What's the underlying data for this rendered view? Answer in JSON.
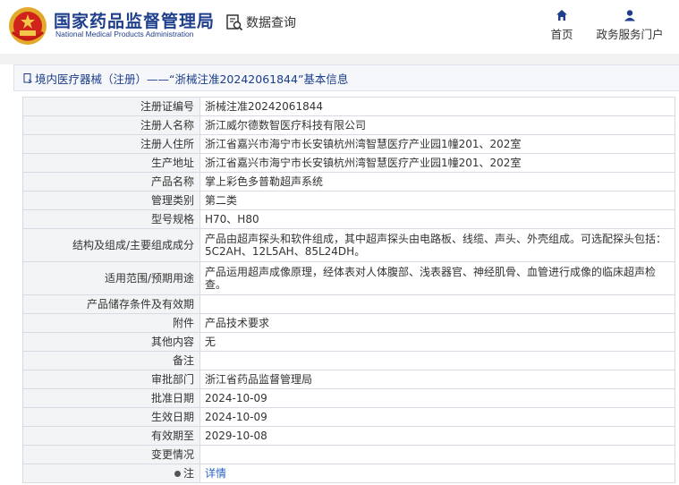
{
  "header": {
    "brand_cn": "国家药品监督管理局",
    "brand_en": "National Medical Products Administration",
    "search_label": "数据查询",
    "nav_home": "首页",
    "nav_service": "政务服务门户"
  },
  "colors": {
    "brand_blue": "#1f3f8c",
    "label_bg": "#f3f4f6",
    "border": "#d7dbe3",
    "link": "#2d62c5"
  },
  "breadcrumb": {
    "text": "境内医疗器械（注册）——“浙械注准20242061844”基本信息"
  },
  "rows": [
    {
      "label": "注册证编号",
      "value": "浙械注准20242061844"
    },
    {
      "label": "注册人名称",
      "value": "浙江威尔德数智医疗科技有限公司"
    },
    {
      "label": "注册人住所",
      "value": "浙江省嘉兴市海宁市长安镇杭州湾智慧医疗产业园1幢201、202室"
    },
    {
      "label": "生产地址",
      "value": "浙江省嘉兴市海宁市长安镇杭州湾智慧医疗产业园1幢201、202室"
    },
    {
      "label": "产品名称",
      "value": "掌上彩色多普勒超声系统"
    },
    {
      "label": "管理类别",
      "value": "第二类"
    },
    {
      "label": "型号规格",
      "value": "H70、H80"
    },
    {
      "label": "结构及组成/主要组成成分",
      "value": "产品由超声探头和软件组成，其中超声探头由电路板、线缆、声头、外壳组成。可选配探头包括：5C2AH、12L5AH、85L24DH。"
    },
    {
      "label": "适用范围/预期用途",
      "value": "产品运用超声成像原理，经体表对人体腹部、浅表器官、神经肌骨、血管进行成像的临床超声检查。"
    },
    {
      "label": "产品储存条件及有效期",
      "value": ""
    },
    {
      "label": "附件",
      "value": "产品技术要求"
    },
    {
      "label": "其他内容",
      "value": "无"
    },
    {
      "label": "备注",
      "value": ""
    },
    {
      "label": "审批部门",
      "value": "浙江省药品监督管理局"
    },
    {
      "label": "批准日期",
      "value": "2024-10-09"
    },
    {
      "label": "生效日期",
      "value": "2024-10-09"
    },
    {
      "label": "有效期至",
      "value": "2029-10-08"
    },
    {
      "label": "变更情况",
      "value": ""
    }
  ],
  "note_row": {
    "label": "注",
    "link": "详情"
  },
  "icons": {
    "logo": "national-emblem-logo",
    "search": "document-search-icon",
    "home": "home-icon",
    "user": "user-icon",
    "breadcrumb": "page-icon"
  }
}
